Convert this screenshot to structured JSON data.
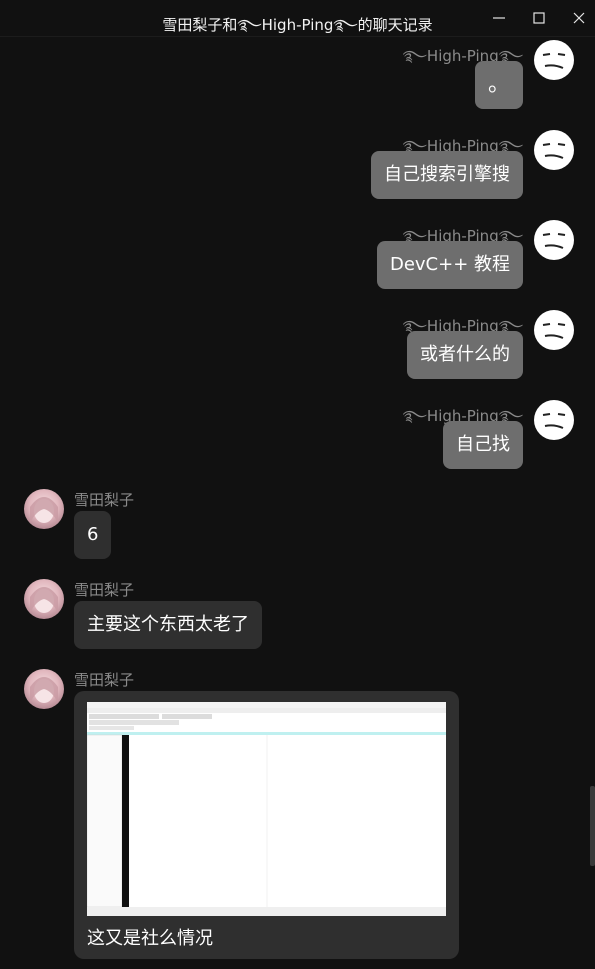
{
  "window": {
    "title": "雪田梨子和࿐High-Ping࿐的聊天记录",
    "minimize_glyph": "—",
    "maximize_glyph": "☐",
    "close_glyph": "✕"
  },
  "messages_out": [
    {
      "sender": "࿐High-Ping࿐",
      "text": "。"
    },
    {
      "sender": "࿐High-Ping࿐",
      "text": "自己搜索引擎搜"
    },
    {
      "sender": "࿐High-Ping࿐",
      "text": "DevC++ 教程"
    },
    {
      "sender": "࿐High-Ping࿐",
      "text": "或者什么的"
    },
    {
      "sender": "࿐High-Ping࿐",
      "text": "自己找"
    }
  ],
  "messages_in": [
    {
      "sender": "雪田梨子",
      "text": "6"
    },
    {
      "sender": "雪田梨子",
      "text": "主要这个东西太老了"
    },
    {
      "sender": "雪田梨子",
      "image": "devcpp-screenshot",
      "caption": "这又是社么情况"
    }
  ],
  "colors": {
    "background": "#111111",
    "out_bubble": "#6e6e6e",
    "in_bubble": "#2f2f2f",
    "sender_name": "#8a8a8a"
  }
}
